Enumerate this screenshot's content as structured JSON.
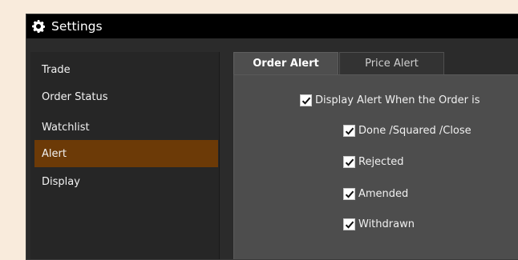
{
  "window": {
    "title": "Settings",
    "icon": "gear-icon"
  },
  "sidebar": {
    "items": [
      {
        "label": "Trade",
        "active": false
      },
      {
        "label": "Order Status",
        "active": false
      },
      {
        "label": "Watchlist",
        "active": false
      },
      {
        "label": "Alert",
        "active": true
      },
      {
        "label": "Display",
        "active": false
      }
    ]
  },
  "tabs": [
    {
      "label": "Order Alert",
      "active": true
    },
    {
      "label": "Price Alert",
      "active": false
    }
  ],
  "order_alert": {
    "main_option": {
      "label": "Display Alert When the Order is",
      "checked": true
    },
    "sub_options": [
      {
        "label": "Done /Squared /Close",
        "checked": true
      },
      {
        "label": "Rejected",
        "checked": true
      },
      {
        "label": "Amended",
        "checked": true
      },
      {
        "label": "Withdrawn",
        "checked": true
      }
    ]
  },
  "colors": {
    "background": "#f9ebdc",
    "titlebar": "#000000",
    "active_item": "#6c3a07",
    "panel": "#4d4d4d"
  }
}
